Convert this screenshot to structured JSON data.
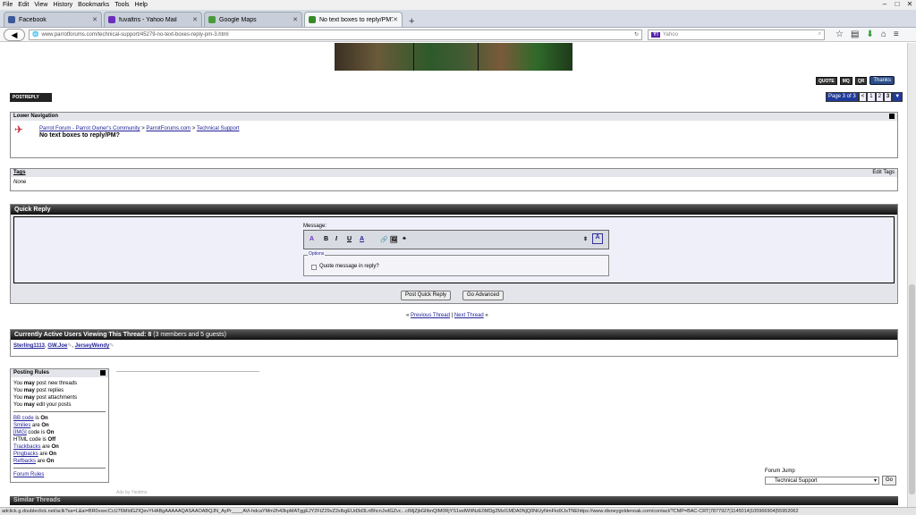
{
  "menu": [
    "File",
    "Edit",
    "View",
    "History",
    "Bookmarks",
    "Tools",
    "Help"
  ],
  "tabs": [
    {
      "label": "Facebook",
      "icon_color": "#3b5998",
      "active": false
    },
    {
      "label": "fuvaltris - Yahoo Mail",
      "icon_color": "#6a2dbd",
      "active": false
    },
    {
      "label": "Google Maps",
      "icon_color": "#4a9a3a",
      "active": false
    },
    {
      "label": "No text boxes to reply/PM?...",
      "icon_color": "#3a8a2a",
      "active": true
    }
  ],
  "url": "www.parrotforums.com/technical-support/45279-no-text-boxes-reply-pm-3.html",
  "search_placeholder": "Yahoo",
  "post_buttons": {
    "quote": "QUOTE",
    "mq": "MQ",
    "qr": "QR",
    "thanks": "Thanks"
  },
  "postreply_label": "POSTREPLY",
  "pagination": {
    "label": "Page 3 of 3",
    "prev": "<",
    "pages": [
      "1",
      "2",
      "3"
    ]
  },
  "lower_nav": {
    "title": "Lower Navigation",
    "crumbs": [
      "Parrot Forum - Parrot Owner's Community",
      "ParrotForums.com",
      "Technical Support"
    ],
    "separator": ">",
    "thread_title": "No text boxes to reply/PM?"
  },
  "tags": {
    "title": "Tags",
    "edit": "Edit Tags",
    "value": "None"
  },
  "quick_reply": {
    "title": "Quick Reply",
    "message_label": "Message:",
    "options_legend": "Options",
    "quote_label": "Quote message in reply?",
    "post_button": "Post Quick Reply",
    "advanced_button": "Go Advanced"
  },
  "thread_nav": {
    "prev": "Previous Thread",
    "sep": "|",
    "next": "Next Thread",
    "left_arrows": "«",
    "right_arrows": "»"
  },
  "active_users": {
    "title": "Currently Active Users Viewing This Thread:",
    "count": "8",
    "detail": "(3 members and 5 guests)",
    "users": [
      "Sterling1113",
      "GW.Joe",
      "JerseyWendy"
    ]
  },
  "posting_rules": {
    "title": "Posting Rules",
    "lines": [
      {
        "pre": "You ",
        "bold": "may",
        "post": " post new threads"
      },
      {
        "pre": "You ",
        "bold": "may",
        "post": " post replies"
      },
      {
        "pre": "You ",
        "bold": "may",
        "post": " post attachments"
      },
      {
        "pre": "You ",
        "bold": "may",
        "post": " edit your posts"
      }
    ],
    "codes": [
      {
        "link": "BB code",
        "mid": " is ",
        "val": "On"
      },
      {
        "link": "Smilies",
        "mid": " are ",
        "val": "On"
      },
      {
        "link": "[IMG]",
        "mid": " code is ",
        "val": "On"
      },
      {
        "link": "",
        "mid": "HTML code is ",
        "val": "Off"
      },
      {
        "link": "Trackbacks",
        "mid": " are ",
        "val": "On"
      },
      {
        "link": "Pingbacks",
        "mid": " are ",
        "val": "On"
      },
      {
        "link": "Refbacks",
        "mid": " are ",
        "val": "On"
      }
    ],
    "forum_rules": "Forum Rules"
  },
  "forum_jump": {
    "label": "Forum Jump",
    "selected": "Technical Support",
    "go": "Go"
  },
  "similar_threads": "Similar Threads",
  "ad_text": "Ads by Yieldmo",
  "status_url": "adclick.g.doubleclick.net/aclk?sa=L&ai=BR0vxecCcU76MIdGZIQevYHABgAAAAAQASAAOABQJN_AyPr____AVi-hdcaYMm2h43kpMATggEJY2FtZ29vZ2xIbgEUd3d3LnBhcnJvdGZvc...cIMjZjbGlIbnQIM0RjYS1wdWItNzE0MDg2MzI1MDA0NjQ0NiUyNmFkdXJsTNEhttps://www.disneygoldenoak.com/contact/?CMP=BAC-CRT|7877927|1145014|105966904|55952062"
}
